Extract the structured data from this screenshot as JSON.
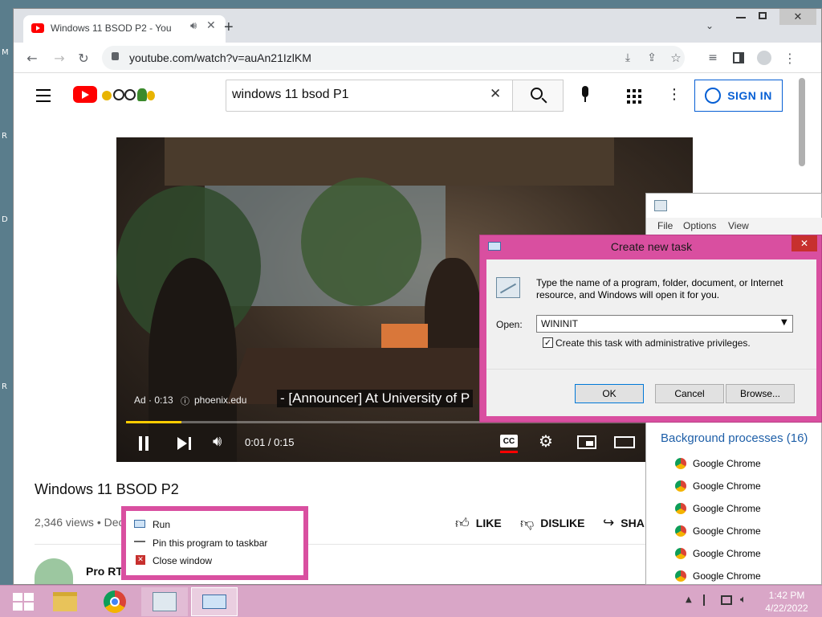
{
  "desktop": {
    "edge_letters": [
      "M",
      "R",
      "D",
      "R"
    ]
  },
  "chrome": {
    "tab_title": "Windows 11 BSOD P2 - YouT",
    "new_tab_symbol": "+",
    "url": "youtube.com/watch?v=auAn21IzlKM"
  },
  "youtube": {
    "search_value": "windows 11 bsod P1",
    "sign_in_label": "SIGN IN",
    "video": {
      "ad_label": "Ad · 0:13",
      "ad_domain": "phoenix.edu",
      "caption": "- [Announcer] At University of P",
      "time": "0:01 / 0:15",
      "progress": 0.1,
      "cc_label": "CC"
    },
    "title": "Windows 11 BSOD P2",
    "views": "2,346 views • Dec",
    "like_label": "LIKE",
    "dislike_label": "DISLIKE",
    "share_label": "SHA",
    "channel": "Pro RTN"
  },
  "task_manager": {
    "menu": [
      "File",
      "Options",
      "View"
    ],
    "section_title": "Background processes (16)",
    "processes": [
      "Google Chrome",
      "Google Chrome",
      "Google Chrome",
      "Google Chrome",
      "Google Chrome",
      "Google Chrome",
      "Google Chrome"
    ]
  },
  "dialog": {
    "title": "Create new task",
    "description": "Type the name of a program, folder, document, or Internet resource, and Windows will open it for you.",
    "open_label": "Open:",
    "open_value": "WININIT",
    "admin_checkbox_label": "Create this task with administrative privileges.",
    "admin_checked": true,
    "ok_label": "OK",
    "cancel_label": "Cancel",
    "browse_label": "Browse..."
  },
  "context_menu": {
    "items": [
      "Run",
      "Pin this program to taskbar",
      "Close window"
    ]
  },
  "taskbar": {
    "time": "1:42 PM",
    "date": "4/22/2022"
  }
}
